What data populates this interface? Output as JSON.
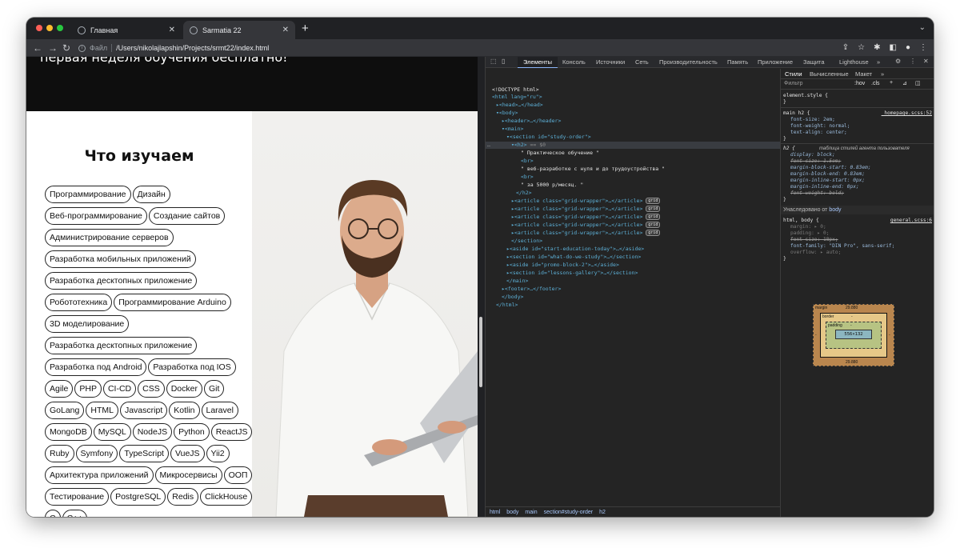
{
  "browser": {
    "tabs": [
      {
        "title": "Главная",
        "active": false
      },
      {
        "title": "Sarmatia 22",
        "active": true
      }
    ],
    "address_scheme": "Файл",
    "address_path": "/Users/nikolajlapshin/Projects/srmt22/index.html"
  },
  "page": {
    "hero_text": "первая неделя обучения бесплатно!",
    "section_title": "Что изучаем",
    "tags": [
      "Программирование",
      "Дизайн",
      "Веб-программирование",
      "Создание сайтов",
      "Администрирование серверов",
      "Разработка мобильных приложений",
      "Разработка десктопных приложение",
      "Робототехника",
      "Программирование Arduino",
      "3D моделирование",
      "Разработка десктопных приложение",
      "Разработка под Android",
      "Разработка под IOS",
      "Agile",
      "PHP",
      "CI-CD",
      "CSS",
      "Docker",
      "Git",
      "GoLang",
      "HTML",
      "Javascript",
      "Kotlin",
      "Laravel",
      "MongoDB",
      "MySQL",
      "NodeJS",
      "Python",
      "ReactJS",
      "Ruby",
      "Symfony",
      "TypeScript",
      "VueJS",
      "Yii2",
      "Архитектура приложений",
      "Микросервисы",
      "ООП",
      "Тестирование",
      "PostgreSQL",
      "Redis",
      "ClickHouse",
      "C",
      "C++"
    ]
  },
  "devtools": {
    "tabs": [
      "Элементы",
      "Консоль",
      "Источники",
      "Сеть",
      "Производительность",
      "Память",
      "Приложение",
      "Защита",
      "Lighthouse"
    ],
    "more": "»",
    "dom": {
      "doctype": "<!DOCTYPE html>",
      "html_open": "<html lang=\"ru\">",
      "head": "<head>…</head>",
      "body_open": "<body>",
      "header": "<header>…</header>",
      "main_open": "<main>",
      "section_open": "<section id=\"study-order\">",
      "h2_open": "<h2>",
      "h2_marker": "== $0",
      "text1": "\" Практическое обучение \"",
      "br1": "<br>",
      "text2": "\" веб-разработке с нуля и до трудоустройства \"",
      "br2": "<br>",
      "text3": "\" за 5000 р/месяц. \"",
      "h2_close": "</h2>",
      "article": "<article class=\"grid-wrapper\">…</article>",
      "grid_badge": "grid",
      "section_close": "</section>",
      "aside1": "<aside id=\"start-education-today\">…</aside>",
      "section2": "<section id=\"what-do-we-study\">…</section>",
      "aside2": "<aside id=\"promo-block-2\">…</aside>",
      "section3": "<section id=\"lessons-gallery\">…</section>",
      "main_close": "</main>",
      "footer": "<footer>…</footer>",
      "body_close": "</body>",
      "html_close": "</html>",
      "ellipsis": "…"
    },
    "breadcrumbs": [
      "html",
      "body",
      "main",
      "section#study-order",
      "h2"
    ],
    "styles": {
      "tabs": [
        "Стили",
        "Вычисленные",
        "Макет",
        "»"
      ],
      "filter_placeholder": "Фильтр",
      "hov": ":hov",
      "cls": ".cls",
      "element_style": "element.style {",
      "close_brace": "}",
      "rule1_selector": "main h2 {",
      "rule1_source": "_homepage.scss:52",
      "rule1_props": [
        "font-size: 2em;",
        "font-weight: normal;",
        "text-align: center;"
      ],
      "rule2_selector": "h2 {",
      "rule2_source": "таблица стилей агента пользователя",
      "rule2_props": [
        "display: block;",
        "font-size: 1.5em;",
        "margin-block-start: 0.83em;",
        "margin-block-end: 0.83em;",
        "margin-inline-start: 0px;",
        "margin-inline-end: 0px;",
        "font-weight: bold;"
      ],
      "inherited_label": "Унаследовано от",
      "inherited_from": "body",
      "rule3_selector": "html, body {",
      "rule3_source": "general.scss:6",
      "rule3_props": [
        "margin: ▸ 0;",
        "padding: ▸ 0;",
        "font-size: 18px;",
        "font-family: \"DIN Pro\", sans-serif;",
        "overflow: ▸ auto;"
      ],
      "box_model": {
        "margin_label": "margin",
        "margin_top": "29.880",
        "margin_bottom": "29.880",
        "border_label": "border",
        "border_value": "-",
        "padding_label": "padding",
        "padding_value": "-",
        "content": "556×132",
        "side_value": "-"
      }
    }
  }
}
